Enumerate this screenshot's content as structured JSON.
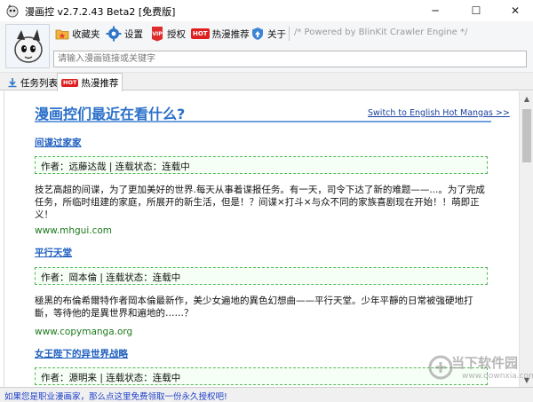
{
  "window": {
    "title": "漫画控 v2.7.2.43 Beta2 [免费版]",
    "minimize": "─",
    "maximize": "☐",
    "close": "✕"
  },
  "toolbar": {
    "favorites": "收藏夹",
    "settings": "设置",
    "authorize": "授权",
    "hot_badge": "HOT",
    "hot_recommend": "热漫推荐",
    "about": "关于",
    "powered_by": "/* Powered by BlinKit Crawler Engine */"
  },
  "search": {
    "placeholder": "请输入漫画链接或关键字",
    "value": ""
  },
  "tabs": [
    {
      "label": "任务列表"
    },
    {
      "badge": "HOT",
      "label": "热漫推荐"
    }
  ],
  "content": {
    "heading": "漫画控们最近在看什么?",
    "switch_link": "Switch to English Hot Mangas >>",
    "manga": [
      {
        "title": "间谍过家家",
        "info": "作者：远藤达哉 | 连载状态：连载中",
        "description": "技艺高超的间谍，为了更加美好的世界.每天从事着谍报任务。有一天，司令下达了新的难题——...。为了完成任务，所临时组建的家庭，所展开的新生活，但是！？间谍×打斗×与众不同的家族喜剧现在开始！！萌即正义！",
        "site": "www.mhgui.com"
      },
      {
        "title": "平行天堂",
        "info": "作者：岡本倫 | 连载状态：连载中",
        "description": "極黑的布倫希爾特作者岡本倫最新作，美少女遍地的異色幻想曲——平行天堂。少年平靜的日常被強硬地打斷，等待他的是異世界和遍地的……？",
        "site": "www.copymanga.org"
      },
      {
        "title": "女王陛下的异世界战略",
        "info": "作者：源明来 | 连载状态：连载中"
      }
    ]
  },
  "status": {
    "link": "如果您是职业漫画家，那么点这里免费领取一份永久授权吧!"
  },
  "watermark": {
    "brand": "当下软件园",
    "url": "www.downxia.com"
  },
  "colors": {
    "accent": "#2a6fc9",
    "link": "#1f5fc0",
    "site_green": "#1c7a1c",
    "hot_red": "#e02020"
  }
}
